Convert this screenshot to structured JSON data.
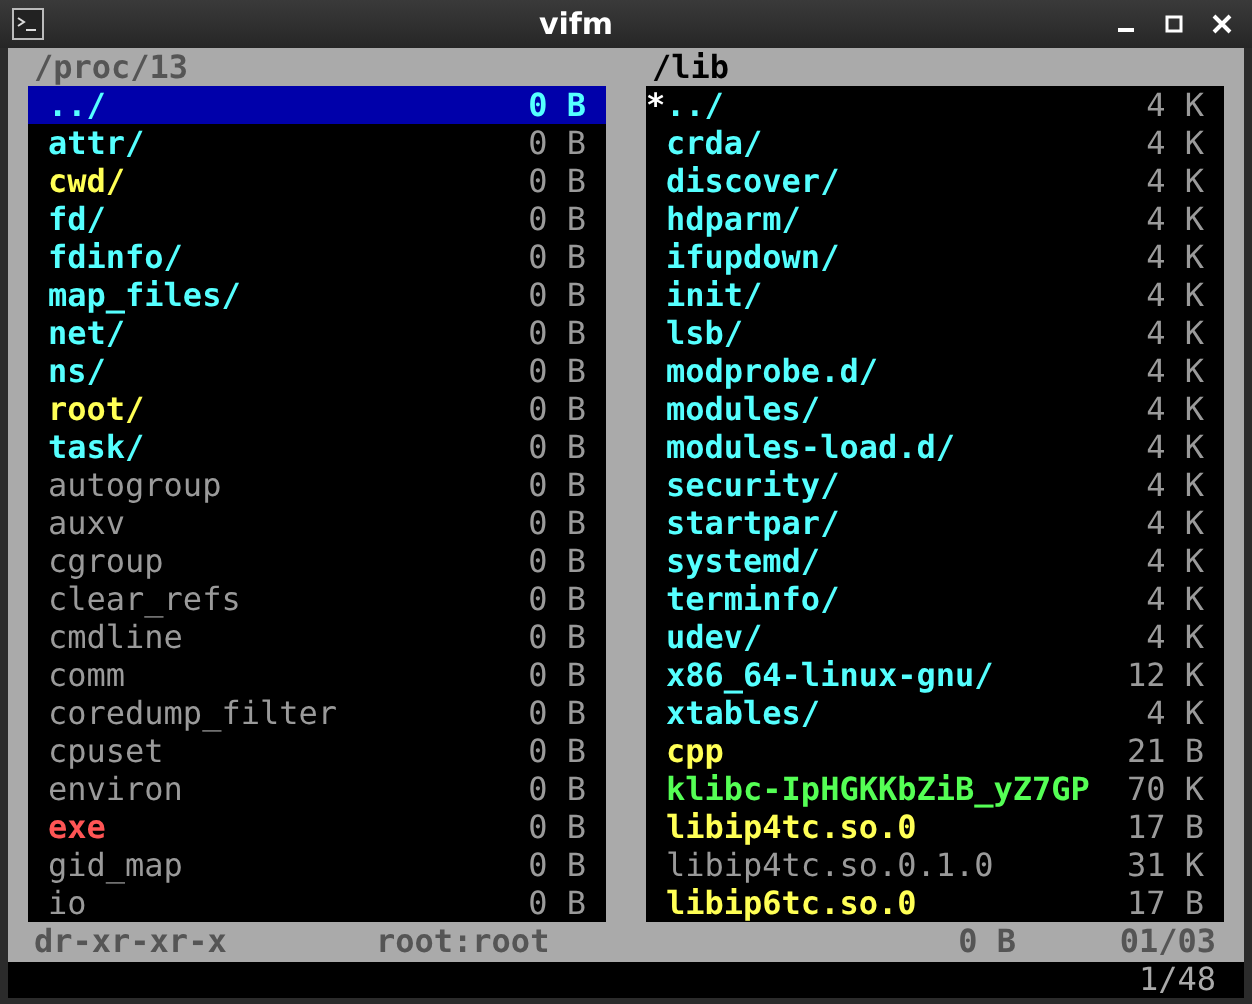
{
  "window": {
    "title": "vifm"
  },
  "panes": [
    {
      "path": "/proc/13",
      "active": true,
      "entries": [
        {
          "name": "../",
          "size": "0 B",
          "kind": "directory",
          "selected": true
        },
        {
          "name": "attr/",
          "size": "0 B",
          "kind": "directory",
          "selected": false
        },
        {
          "name": "cwd/",
          "size": "0 B",
          "kind": "link",
          "selected": false
        },
        {
          "name": "fd/",
          "size": "0 B",
          "kind": "directory",
          "selected": false
        },
        {
          "name": "fdinfo/",
          "size": "0 B",
          "kind": "directory",
          "selected": false
        },
        {
          "name": "map_files/",
          "size": "0 B",
          "kind": "directory",
          "selected": false
        },
        {
          "name": "net/",
          "size": "0 B",
          "kind": "directory",
          "selected": false
        },
        {
          "name": "ns/",
          "size": "0 B",
          "kind": "directory",
          "selected": false
        },
        {
          "name": "root/",
          "size": "0 B",
          "kind": "link",
          "selected": false
        },
        {
          "name": "task/",
          "size": "0 B",
          "kind": "directory",
          "selected": false
        },
        {
          "name": "autogroup",
          "size": "0 B",
          "kind": "file",
          "selected": false
        },
        {
          "name": "auxv",
          "size": "0 B",
          "kind": "file",
          "selected": false
        },
        {
          "name": "cgroup",
          "size": "0 B",
          "kind": "file",
          "selected": false
        },
        {
          "name": "clear_refs",
          "size": "0 B",
          "kind": "file",
          "selected": false
        },
        {
          "name": "cmdline",
          "size": "0 B",
          "kind": "file",
          "selected": false
        },
        {
          "name": "comm",
          "size": "0 B",
          "kind": "file",
          "selected": false
        },
        {
          "name": "coredump_filter",
          "size": "0 B",
          "kind": "file",
          "selected": false
        },
        {
          "name": "cpuset",
          "size": "0 B",
          "kind": "file",
          "selected": false
        },
        {
          "name": "environ",
          "size": "0 B",
          "kind": "file",
          "selected": false
        },
        {
          "name": "exe",
          "size": "0 B",
          "kind": "broken",
          "selected": false
        },
        {
          "name": "gid_map",
          "size": "0 B",
          "kind": "file",
          "selected": false
        },
        {
          "name": "io",
          "size": "0 B",
          "kind": "file",
          "selected": false
        }
      ]
    },
    {
      "path": "/lib",
      "active": false,
      "entries": [
        {
          "name": "../",
          "size": "4 K",
          "kind": "directory",
          "marker": "*"
        },
        {
          "name": "crda/",
          "size": "4 K",
          "kind": "directory",
          "selected": false
        },
        {
          "name": "discover/",
          "size": "4 K",
          "kind": "directory",
          "selected": false
        },
        {
          "name": "hdparm/",
          "size": "4 K",
          "kind": "directory",
          "selected": false
        },
        {
          "name": "ifupdown/",
          "size": "4 K",
          "kind": "directory",
          "selected": false
        },
        {
          "name": "init/",
          "size": "4 K",
          "kind": "directory",
          "selected": false
        },
        {
          "name": "lsb/",
          "size": "4 K",
          "kind": "directory",
          "selected": false
        },
        {
          "name": "modprobe.d/",
          "size": "4 K",
          "kind": "directory",
          "selected": false
        },
        {
          "name": "modules/",
          "size": "4 K",
          "kind": "directory",
          "selected": false
        },
        {
          "name": "modules-load.d/",
          "size": "4 K",
          "kind": "directory",
          "selected": false
        },
        {
          "name": "security/",
          "size": "4 K",
          "kind": "directory",
          "selected": false
        },
        {
          "name": "startpar/",
          "size": "4 K",
          "kind": "directory",
          "selected": false
        },
        {
          "name": "systemd/",
          "size": "4 K",
          "kind": "directory",
          "selected": false
        },
        {
          "name": "terminfo/",
          "size": "4 K",
          "kind": "directory",
          "selected": false
        },
        {
          "name": "udev/",
          "size": "4 K",
          "kind": "directory",
          "selected": false
        },
        {
          "name": "x86_64-linux-gnu/",
          "size": "12 K",
          "kind": "directory",
          "selected": false
        },
        {
          "name": "xtables/",
          "size": "4 K",
          "kind": "directory",
          "selected": false
        },
        {
          "name": "cpp",
          "size": "21 B",
          "kind": "link",
          "selected": false
        },
        {
          "name": "klibc-IpHGKKbZiB_yZ7GP",
          "size": "70 K",
          "kind": "executable",
          "selected": false
        },
        {
          "name": "libip4tc.so.0",
          "size": "17 B",
          "kind": "link",
          "selected": false
        },
        {
          "name": "libip4tc.so.0.1.0",
          "size": "31 K",
          "kind": "file",
          "selected": false
        },
        {
          "name": "libip6tc.so.0",
          "size": "17 B",
          "kind": "link",
          "selected": false
        }
      ]
    }
  ],
  "status_bar": {
    "permissions": "dr-xr-xr-x",
    "owner": "root:root",
    "size": "0 B",
    "position": "01/03"
  },
  "command_line": {
    "counter": "1/48"
  }
}
